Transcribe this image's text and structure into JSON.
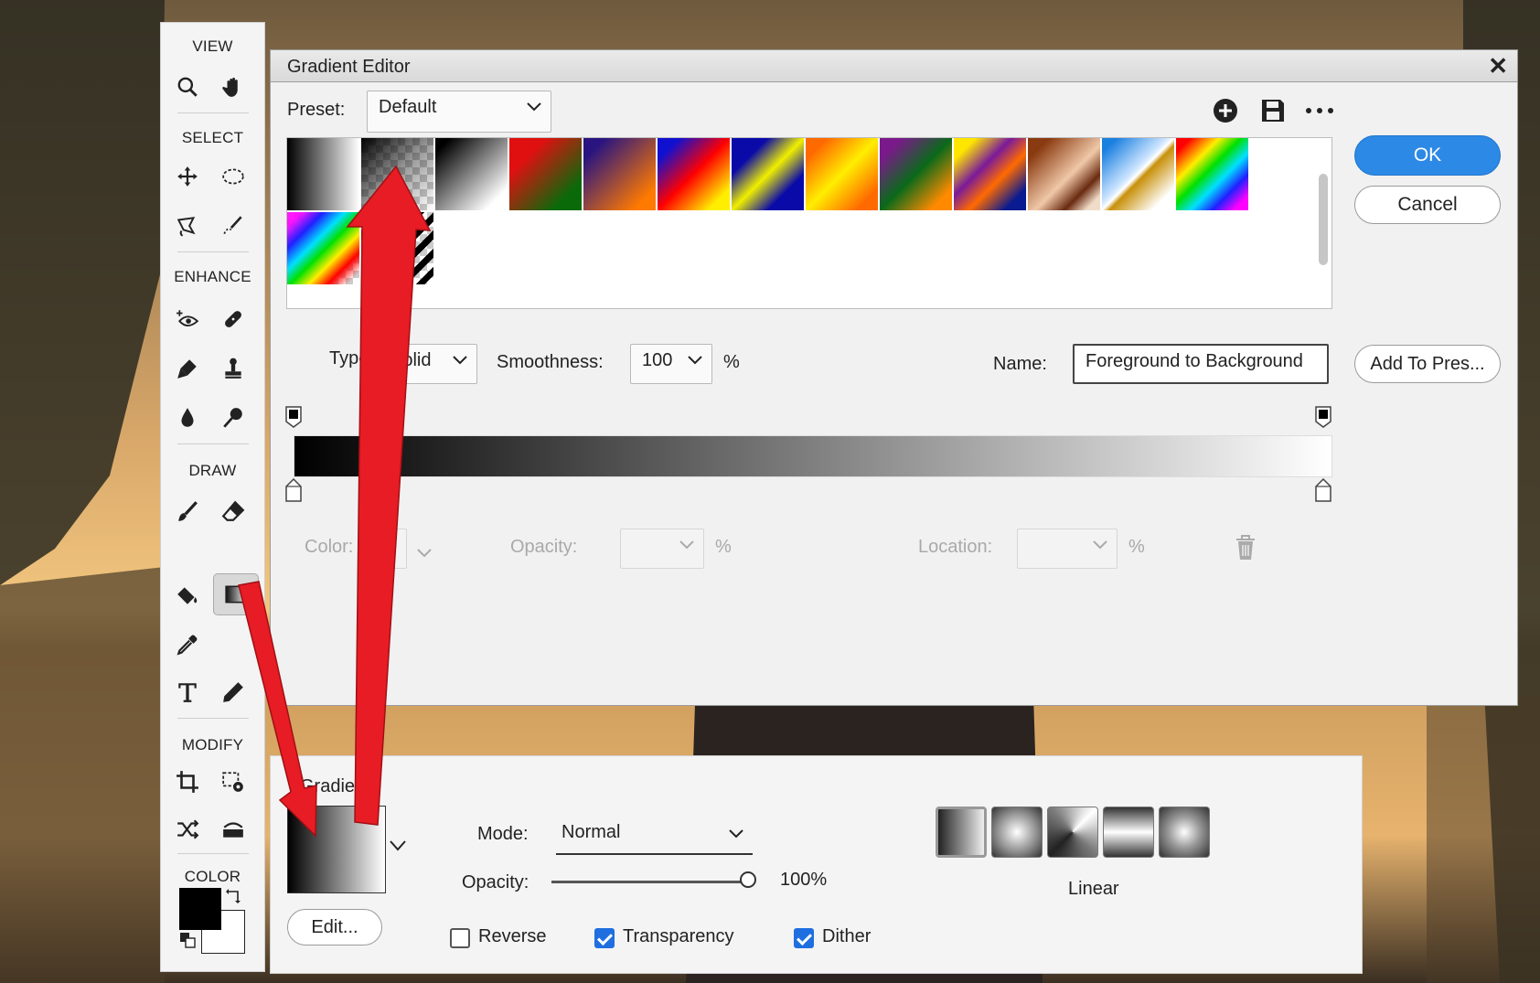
{
  "toolbar": {
    "sections": {
      "view": "VIEW",
      "select": "SELECT",
      "enhance": "ENHANCE",
      "draw": "DRAW",
      "modify": "MODIFY",
      "color": "COLOR"
    }
  },
  "dialog": {
    "title": "Gradient Editor",
    "preset_label": "Preset:",
    "preset_value": "Default",
    "ok": "OK",
    "cancel": "Cancel",
    "type_label": "Type:",
    "type_value": "Solid",
    "smoothness_label": "Smoothness:",
    "smoothness_value": "100",
    "percent": "%",
    "name_label": "Name:",
    "name_value": "Foreground to Background",
    "add_to_preset": "Add To Pres...",
    "color_label": "Color:",
    "opacity_label": "Opacity:",
    "location_label": "Location:",
    "presets": [
      {
        "name": "fg-to-bg",
        "css": "linear-gradient(to right,#000,#fff)"
      },
      {
        "name": "fg-to-transparent",
        "css": "linear-gradient(135deg,#000 0%,rgba(0,0,0,0.4) 50%,rgba(0,0,0,0) 100%)",
        "checker": true
      },
      {
        "name": "black-white",
        "css": "linear-gradient(135deg,#000 10%,#fff 85%)"
      },
      {
        "name": "red-green",
        "css": "linear-gradient(135deg,#e01010 25%,#0a6a0a 80%)"
      },
      {
        "name": "violet-orange",
        "css": "linear-gradient(135deg,#2a1580 15%,#ff7a00 85%)"
      },
      {
        "name": "blue-red-yellow",
        "css": "linear-gradient(135deg,#1010d0 15%,#ff0000 50%,#ffee00 85%)"
      },
      {
        "name": "blue-yellow-blue",
        "css": "linear-gradient(135deg,#0a0aa8 25%,#f0f000 50%,#0a0aa8 75%)"
      },
      {
        "name": "orange-yellow-orange",
        "css": "linear-gradient(135deg,#ff6a00 15%,#ffee00 50%,#ff6a00 85%)"
      },
      {
        "name": "violet-green-orange",
        "css": "linear-gradient(135deg,#7a1a8a 15%,#0a6a1a 50%,#ff8a00 85%)"
      },
      {
        "name": "yellow-violet-orange-blue",
        "css": "linear-gradient(135deg,#ffe600 15%,#7a1a9a 40%,#ff6a00 60%,#0a1a90 85%)"
      },
      {
        "name": "copper",
        "css": "linear-gradient(135deg,#8a3a10 15%,#f0c8a8 55%,#6a2a10 75%,#f0dcc8 90%)"
      },
      {
        "name": "chrome",
        "css": "linear-gradient(135deg,#1a80e0 10%,#cfe6ff 45%,#fff 50%,#c8900a 55%,#fff 85%)"
      },
      {
        "name": "spectrum",
        "css": "linear-gradient(135deg,#ff0000 10%,#ffee00 30%,#00e000 45%,#00e0ff 60%,#2020ff 75%,#ff00ff 90%)"
      },
      {
        "name": "transparent-rainbow",
        "css": "linear-gradient(135deg,rgba(255,0,255,0.9) 10%,#2020ff 25%,#00e0ff 40%,#00e000 52%,#ffee00 65%,#ff0000 78%,rgba(255,255,255,0) 92%)",
        "checker": true
      },
      {
        "name": "transparent-stripes",
        "css": "repeating-linear-gradient(135deg,#000 0 7px,rgba(0,0,0,0) 7px 14px)",
        "checker": true
      }
    ]
  },
  "options": {
    "gradient_label": "Gradient",
    "edit": "Edit...",
    "mode_label": "Mode:",
    "mode_value": "Normal",
    "opacity_label": "Opacity:",
    "opacity_value": "100%",
    "opacity_level": 1.0,
    "type_name": "Linear",
    "reverse_label": "Reverse",
    "reverse": false,
    "transparency_label": "Transparency",
    "transparency": true,
    "dither_label": "Dither",
    "dither": true,
    "gradient_types": [
      "linear",
      "radial",
      "angle",
      "reflected",
      "diamond"
    ]
  },
  "colors": {
    "ok_blue": "#2d89e6",
    "arrow_red": "#e81c24",
    "checkbox_blue": "#1f6fe0"
  }
}
